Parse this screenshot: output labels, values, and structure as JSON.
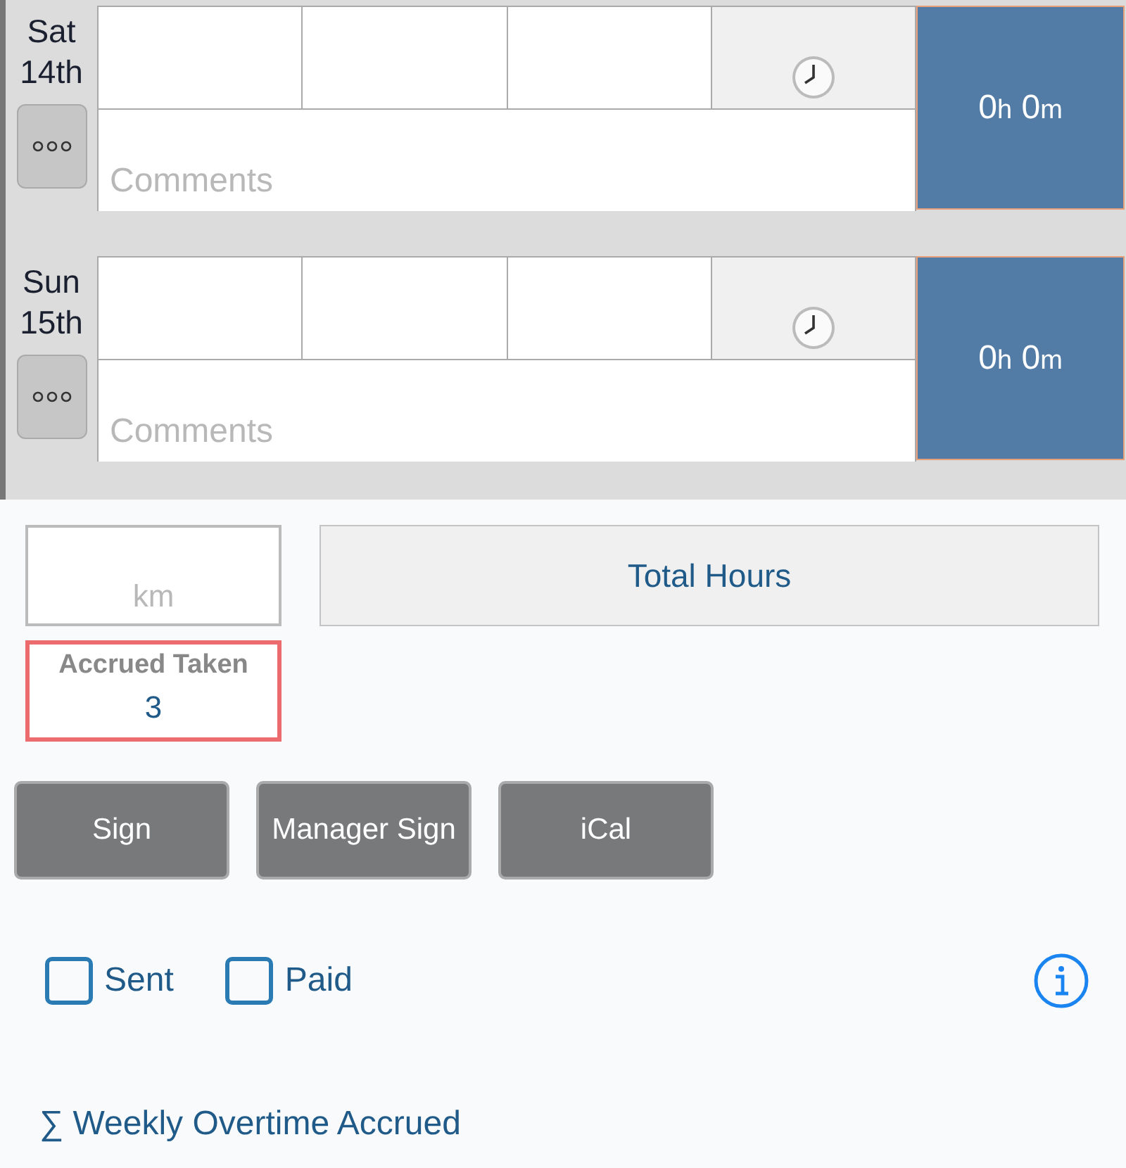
{
  "days": [
    {
      "day": "Sat",
      "date": "14th",
      "cells": [
        "",
        "",
        ""
      ],
      "comments": {
        "placeholder": "Comments"
      },
      "total": {
        "hours": "0",
        "hours_unit": "h",
        "minutes": "0",
        "minutes_unit": "m"
      }
    },
    {
      "day": "Sun",
      "date": "15th",
      "cells": [
        "",
        "",
        ""
      ],
      "comments": {
        "placeholder": "Comments"
      },
      "total": {
        "hours": "0",
        "hours_unit": "h",
        "minutes": "0",
        "minutes_unit": "m"
      }
    }
  ],
  "distance": {
    "placeholder": "km"
  },
  "total_hours_button": "Total Hours",
  "accrued": {
    "label": "Accrued Taken",
    "value": "3",
    "highlighted": true
  },
  "buttons": [
    "Sign",
    "Manager Sign",
    "iCal"
  ],
  "checkboxes": [
    {
      "label": "Sent",
      "checked": false
    },
    {
      "label": "Paid",
      "checked": false
    }
  ],
  "overtime_link": "∑ Weekly Overtime Accrued"
}
